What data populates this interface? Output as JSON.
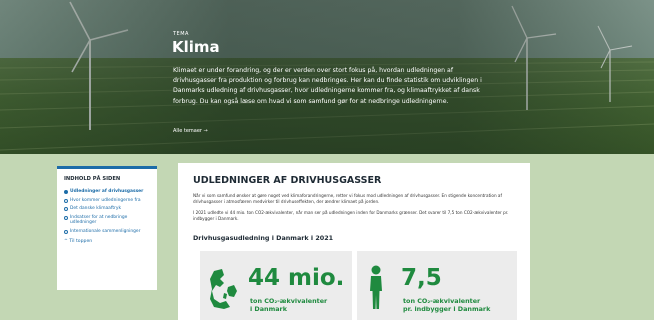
{
  "hero": {
    "eyebrow": "TEMA",
    "title": "Klima",
    "intro": "Klimaet er under forandring, og der er verden over stort fokus på, hvordan udledningen af drivhusgasser fra produktion og forbrug kan nedbringes. Her kan du finde statistik om udviklingen i Danmarks udledning af drivhusgasser, hvor udledningerne kommer fra, og klimaaftrykket af dansk forbrug. Du kan også læse om hvad vi som samfund gør for at nedbringe udledningerne.",
    "all_themes_link": "Alle temaer →"
  },
  "toc": {
    "heading": "INDHOLD PÅ SIDEN",
    "items": [
      {
        "label": "Udledninger af drivhusgasser",
        "active": true
      },
      {
        "label": "Hvor kommer udledningerne fra",
        "active": false
      },
      {
        "label": "Det danske klimaaftryk",
        "active": false
      },
      {
        "label": "Indsatser for at nedbringe udledninger",
        "active": false
      },
      {
        "label": "Internationale sammenligninger",
        "active": false
      }
    ],
    "back_to_top": "Til toppen"
  },
  "main": {
    "heading": "UDLEDNINGER AF DRIVHUSGASSER",
    "paragraph1": "Når vi som samfund ønsker at gøre noget ved klimaforandringerne, retter vi fokus mod udledningen af drivhusgasser. En stigende koncentration af drivhusgasser i atmosfæren medvirker til drivhuseffekten, der ændrer klimaet på jorden.",
    "paragraph2": "I 2021 udledte vi 44 mio. ton CO2-ækvivalenter, når man ser på udledningen inden for Danmarks grænser. Det svarer til 7,5 ton CO2-ækvivalenter pr. indbygger i Danmark.",
    "subheading": "Drivhusgasudledning i Danmark i 2021",
    "stats": [
      {
        "value": "44 mio.",
        "line1": "ton CO₂-ækvivalenter",
        "line2": "i Danmark",
        "icon": "denmark-map-icon"
      },
      {
        "value": "7,5",
        "line1": "ton CO₂-ækvivalenter",
        "line2": "pr. indbygger i Danmark",
        "icon": "person-icon"
      }
    ]
  },
  "colors": {
    "accent_blue": "#1c6ca8",
    "stat_green": "#1f8a3f",
    "page_bg": "#c3d7b4"
  }
}
